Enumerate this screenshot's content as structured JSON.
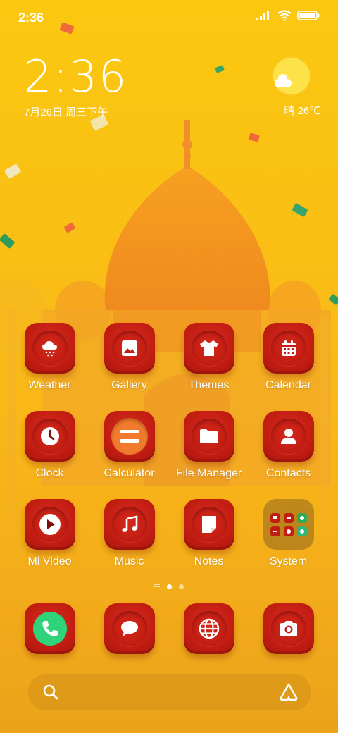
{
  "status_bar": {
    "time": "2:36",
    "icons": [
      "signal-icon",
      "wifi-icon",
      "battery-icon"
    ]
  },
  "clock_widget": {
    "time": "2:36",
    "date": "7月26日 周三下午"
  },
  "weather_widget": {
    "icon": "partly-sunny-icon",
    "text": "晴 26℃"
  },
  "apps": [
    {
      "id": "weather",
      "label": "Weather",
      "icon": "weather-icon"
    },
    {
      "id": "gallery",
      "label": "Gallery",
      "icon": "gallery-icon"
    },
    {
      "id": "themes",
      "label": "Themes",
      "icon": "themes-icon"
    },
    {
      "id": "calendar",
      "label": "Calendar",
      "icon": "calendar-icon"
    },
    {
      "id": "clock",
      "label": "Clock",
      "icon": "clock-icon"
    },
    {
      "id": "calculator",
      "label": "Calculator",
      "icon": "calculator-icon"
    },
    {
      "id": "file-manager",
      "label": "File Manager",
      "icon": "folder-icon"
    },
    {
      "id": "contacts",
      "label": "Contacts",
      "icon": "contacts-icon"
    },
    {
      "id": "mi-video",
      "label": "Mi Video",
      "icon": "play-icon"
    },
    {
      "id": "music",
      "label": "Music",
      "icon": "music-icon"
    },
    {
      "id": "notes",
      "label": "Notes",
      "icon": "notes-icon"
    },
    {
      "id": "system",
      "label": "System",
      "icon": "folder-grid-icon"
    }
  ],
  "page_indicator": {
    "pages": 2,
    "active": 1
  },
  "dock": [
    {
      "id": "phone",
      "icon": "phone-icon"
    },
    {
      "id": "messages",
      "icon": "message-icon"
    },
    {
      "id": "browser",
      "icon": "globe-icon"
    },
    {
      "id": "camera",
      "icon": "camera-icon"
    }
  ],
  "search_bar": {
    "left_icon": "search-icon",
    "right_icon": "assistant-icon"
  },
  "colors": {
    "background": "#fbc80f",
    "icon_red": "#c21d12",
    "palace_orange": "#f3811e"
  }
}
